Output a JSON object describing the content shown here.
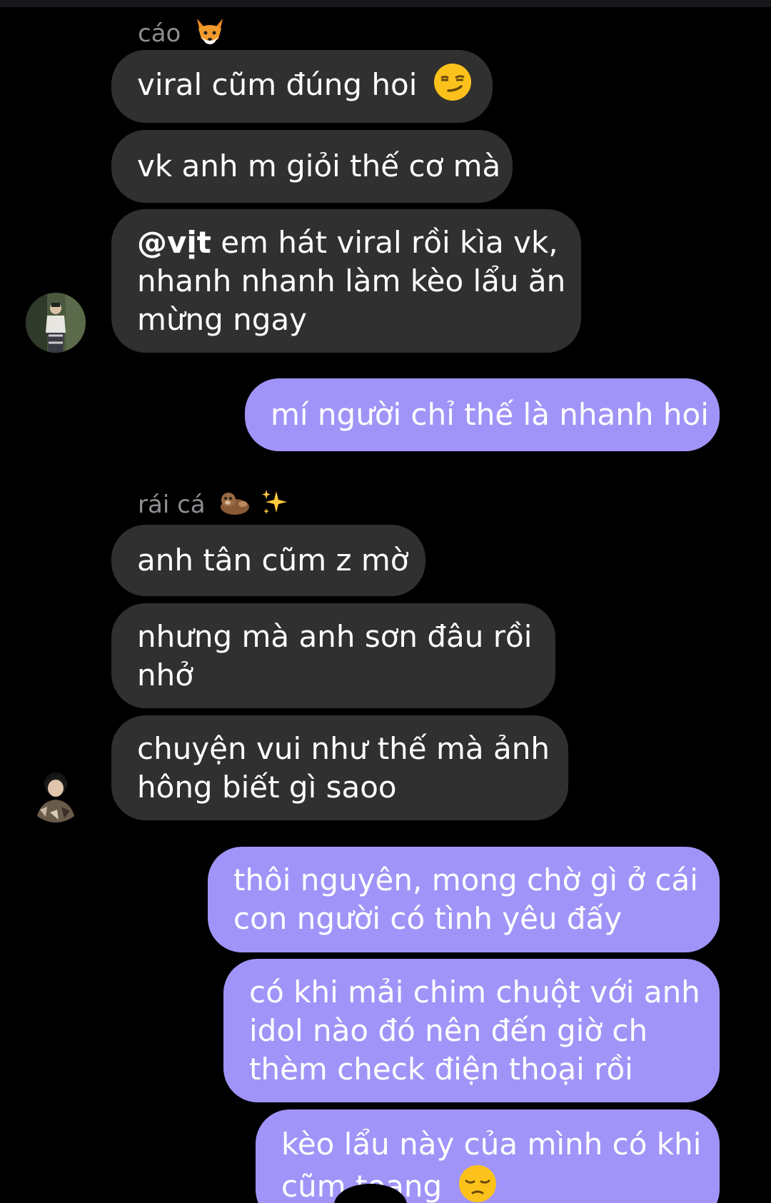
{
  "chat": {
    "group1": {
      "sender": "cáo",
      "sender_emoji": "fox-icon",
      "messages": [
        {
          "text": "viral cũm đúng hoi",
          "emoji": "smirk-emoji"
        },
        {
          "text": "vk anh m giỏi thế cơ mà"
        },
        {
          "mention": "@vịt",
          "lines": [
            " em hát viral rồi kìa vk,",
            "nhanh nhanh làm kèo lẩu ăn",
            "mừng ngay"
          ]
        }
      ]
    },
    "outgoing1": {
      "text": "mí người chỉ thế là nhanh hoi"
    },
    "group2": {
      "sender": "rái cá",
      "sender_emojis": [
        "otter-icon",
        "sparkles-icon"
      ],
      "messages": [
        {
          "text": "anh tân cũm z mờ"
        },
        {
          "lines": [
            "nhưng mà anh sơn đâu rồi",
            "nhở"
          ]
        },
        {
          "lines": [
            "chuyện vui như thế mà ảnh",
            "hông biết gì saoo"
          ]
        }
      ]
    },
    "outgoing2": {
      "messages": [
        {
          "lines": [
            "thôi nguyên, mong chờ gì ở cái",
            "con người có tình yêu đấy"
          ]
        },
        {
          "lines": [
            "có khi mải chim chuột với anh",
            "idol nào đó nên đến giờ ch",
            "thèm check điện thoại rồi"
          ]
        },
        {
          "lines": [
            "kèo lẩu này của mình có khi",
            "cũm toang"
          ],
          "emoji": "pensive-emoji"
        }
      ]
    }
  },
  "colors": {
    "background": "#000000",
    "incoming_bubble": "#303030",
    "outgoing_bubble": "#a194f8",
    "sender_name": "#8e8e93",
    "text": "#ffffff"
  }
}
